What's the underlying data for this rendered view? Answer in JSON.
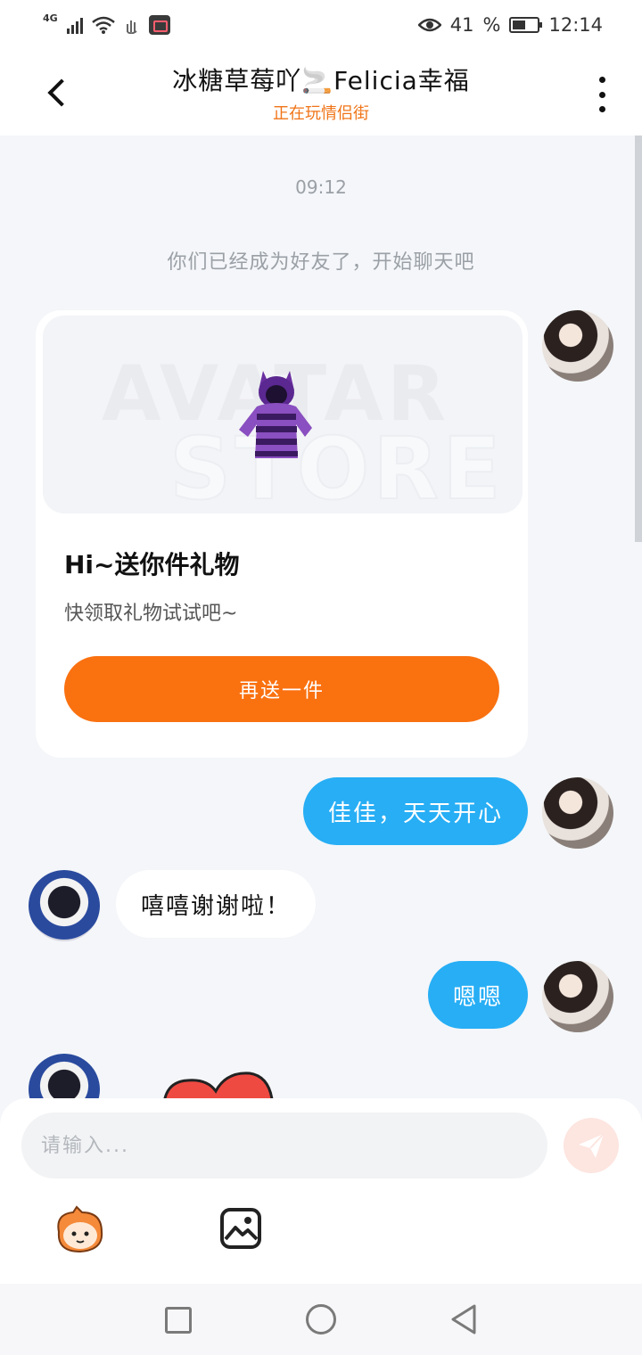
{
  "status_bar": {
    "signal_label": "4G",
    "battery_percent": "41",
    "time": "12:14"
  },
  "header": {
    "title": "冰糖草莓吖🚬Felicia幸福",
    "subtitle": "正在玩情侣街"
  },
  "chat": {
    "time_label": "09:12",
    "system_message": "你们已经成为好友了，开始聊天吧",
    "gift_card": {
      "watermark_line1": "AVATAR",
      "watermark_line2": "STORE",
      "title": "Hi~送你件礼物",
      "description": "快领取礼物试试吧~",
      "button_label": "再送一件"
    },
    "messages": [
      {
        "sender": "me",
        "text": "佳佳，天天开心"
      },
      {
        "sender": "them",
        "text": "嘻嘻谢谢啦！"
      },
      {
        "sender": "me",
        "text": "嗯嗯"
      }
    ]
  },
  "composer": {
    "placeholder": "请输入..."
  },
  "colors": {
    "accent_orange": "#fa7110",
    "bubble_blue": "#27aef5",
    "subtitle_orange": "#f07418"
  },
  "icons": {
    "back": "chevron-left-icon",
    "more": "more-vertical-icon",
    "send": "send-icon",
    "emoji": "emoji-sticker-icon",
    "image": "image-icon"
  }
}
